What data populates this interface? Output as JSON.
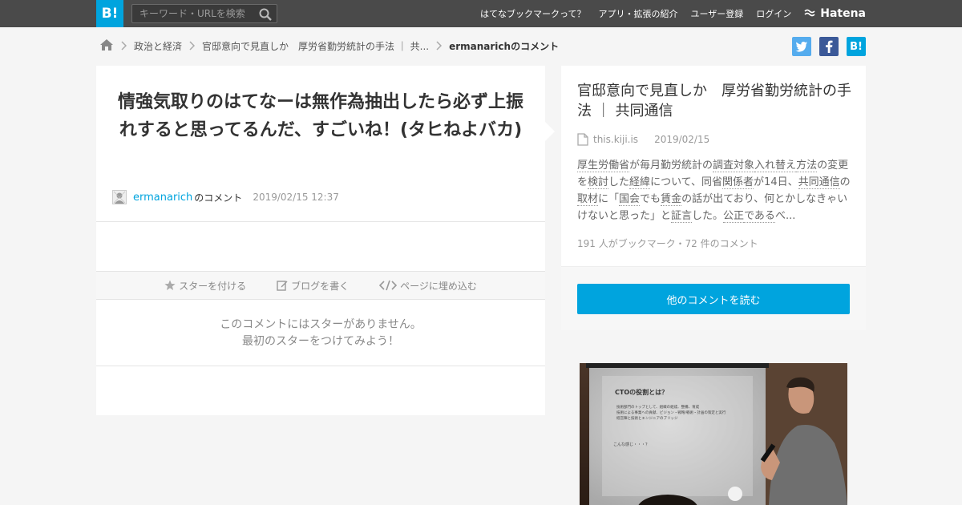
{
  "header": {
    "logo": "B!",
    "search_placeholder": "キーワード・URLを検索",
    "nav": [
      "はてなブックマークって？",
      "アプリ・拡張の紹介",
      "ユーザー登録",
      "ログイン"
    ],
    "brand": "Hatena"
  },
  "breadcrumb": {
    "items": [
      "政治と経済",
      "官邸意向で見直しか　厚労省勤労統計の手法 ｜ 共..."
    ],
    "current": "ermanarichのコメント"
  },
  "share": {
    "hatena_label": "B!"
  },
  "comment": {
    "text": "情強気取りのはてなーは無作為抽出したら必ず上振れすると思ってるんだ、すごいね！(タヒねよバカ)",
    "user": "ermanarich",
    "user_suffix": "のコメント",
    "date": "2019/02/15 12:37"
  },
  "actions": {
    "star": "スターを付ける",
    "blog": "ブログを書く",
    "embed": "ページに埋め込む"
  },
  "no_star": {
    "line1": "このコメントにはスターがありません。",
    "line2": "最初のスターをつけてみよう！"
  },
  "entry": {
    "title": "官邸意向で見直しか　厚労省勤労統計の手法 ｜ 共同通信",
    "domain": "this.kiji.is",
    "date": "2019/02/15",
    "summary_parts": [
      "厚生労働省",
      "が毎月勤労統計の",
      "調査対象",
      "入れ替え",
      "方法",
      "の変更を",
      "検討",
      "した",
      "経緯",
      "について、同省",
      "関係者",
      "が14日、",
      "共同通信",
      "の",
      "取材",
      "に「",
      "国会",
      "でも",
      "賃金",
      "の話が出ており、何とかしなきゃいけないと思った」と",
      "証言",
      "した。",
      "公正",
      "である",
      "べ..."
    ],
    "counts": "191 人がブックマーク・72 件のコメント",
    "read_button": "他のコメントを読む"
  },
  "ad_slide": {
    "title": "CTOの役割とは？",
    "bullets": [
      "技術部門のトップとして、組織の組成、整備、育成",
      "技術による事業への貢献、ビジョン・戦略/戦術・計画の策定と実行",
      "経営陣と技術とエンジニアのブリッジ"
    ],
    "footer": "こんな感じ・・・？"
  },
  "colors": {
    "accent": "#00a4de",
    "topbar": "#4a4a4a",
    "twitter": "#55acee",
    "facebook": "#3b5998"
  }
}
